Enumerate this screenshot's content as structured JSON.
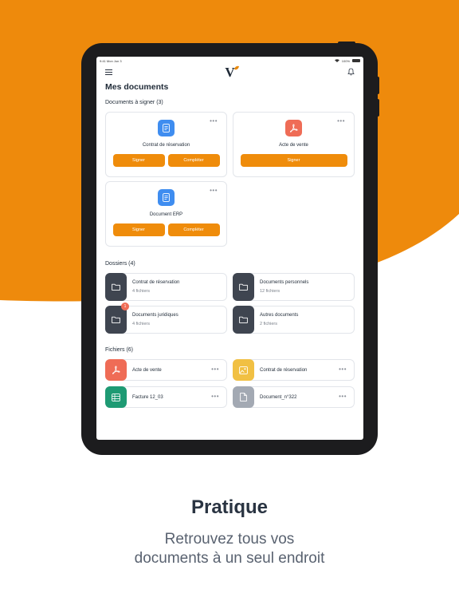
{
  "colors": {
    "accent": "#ef8c0b",
    "background_orange": "#ee8a0c",
    "folder_dark": "#3f4550",
    "pdf_red": "#ef6c56",
    "doc_blue": "#3f8df0",
    "sheet_green": "#1e9a73",
    "img_yellow": "#f1c043",
    "file_grey": "#a3a9b3"
  },
  "status_bar": {
    "time": "9:41 Mon Jun 3",
    "battery": "100%"
  },
  "app": {
    "logo_letter": "V"
  },
  "page": {
    "title": "Mes documents"
  },
  "sign_section": {
    "title": "Documents à signer (3)",
    "cards": [
      {
        "name": "Contrat de réservation",
        "icon": "document-icon",
        "sign_label": "Signer",
        "complete_label": "Compléter"
      },
      {
        "name": "Acte de vente",
        "icon": "pdf-icon",
        "sign_label": "Signer"
      },
      {
        "name": "Document ERP",
        "icon": "document-icon",
        "sign_label": "Signer",
        "complete_label": "Compléter"
      }
    ],
    "more_label": "•••"
  },
  "folders_section": {
    "title": "Dossiers (4)",
    "items": [
      {
        "name": "Contrat de réservation",
        "count": "4 fichiers"
      },
      {
        "name": "Documents personnels",
        "count": "12 fichiers"
      },
      {
        "name": "Documents juridiques",
        "count": "4 fichiers",
        "badge": "1"
      },
      {
        "name": "Autres documents",
        "count": "2 fichiers"
      }
    ]
  },
  "files_section": {
    "title": "Fichiers (6)",
    "items": [
      {
        "name": "Acte de vente",
        "icon": "pdf-icon"
      },
      {
        "name": "Contrat de réservation",
        "icon": "image-icon"
      },
      {
        "name": "Facture 12_03",
        "icon": "spreadsheet-icon"
      },
      {
        "name": "Document_n°322",
        "icon": "file-icon"
      }
    ],
    "more_label": "•••"
  },
  "caption": {
    "title": "Pratique",
    "subtitle_line1": "Retrouvez tous vos",
    "subtitle_line2": "documents à un seul endroit"
  }
}
